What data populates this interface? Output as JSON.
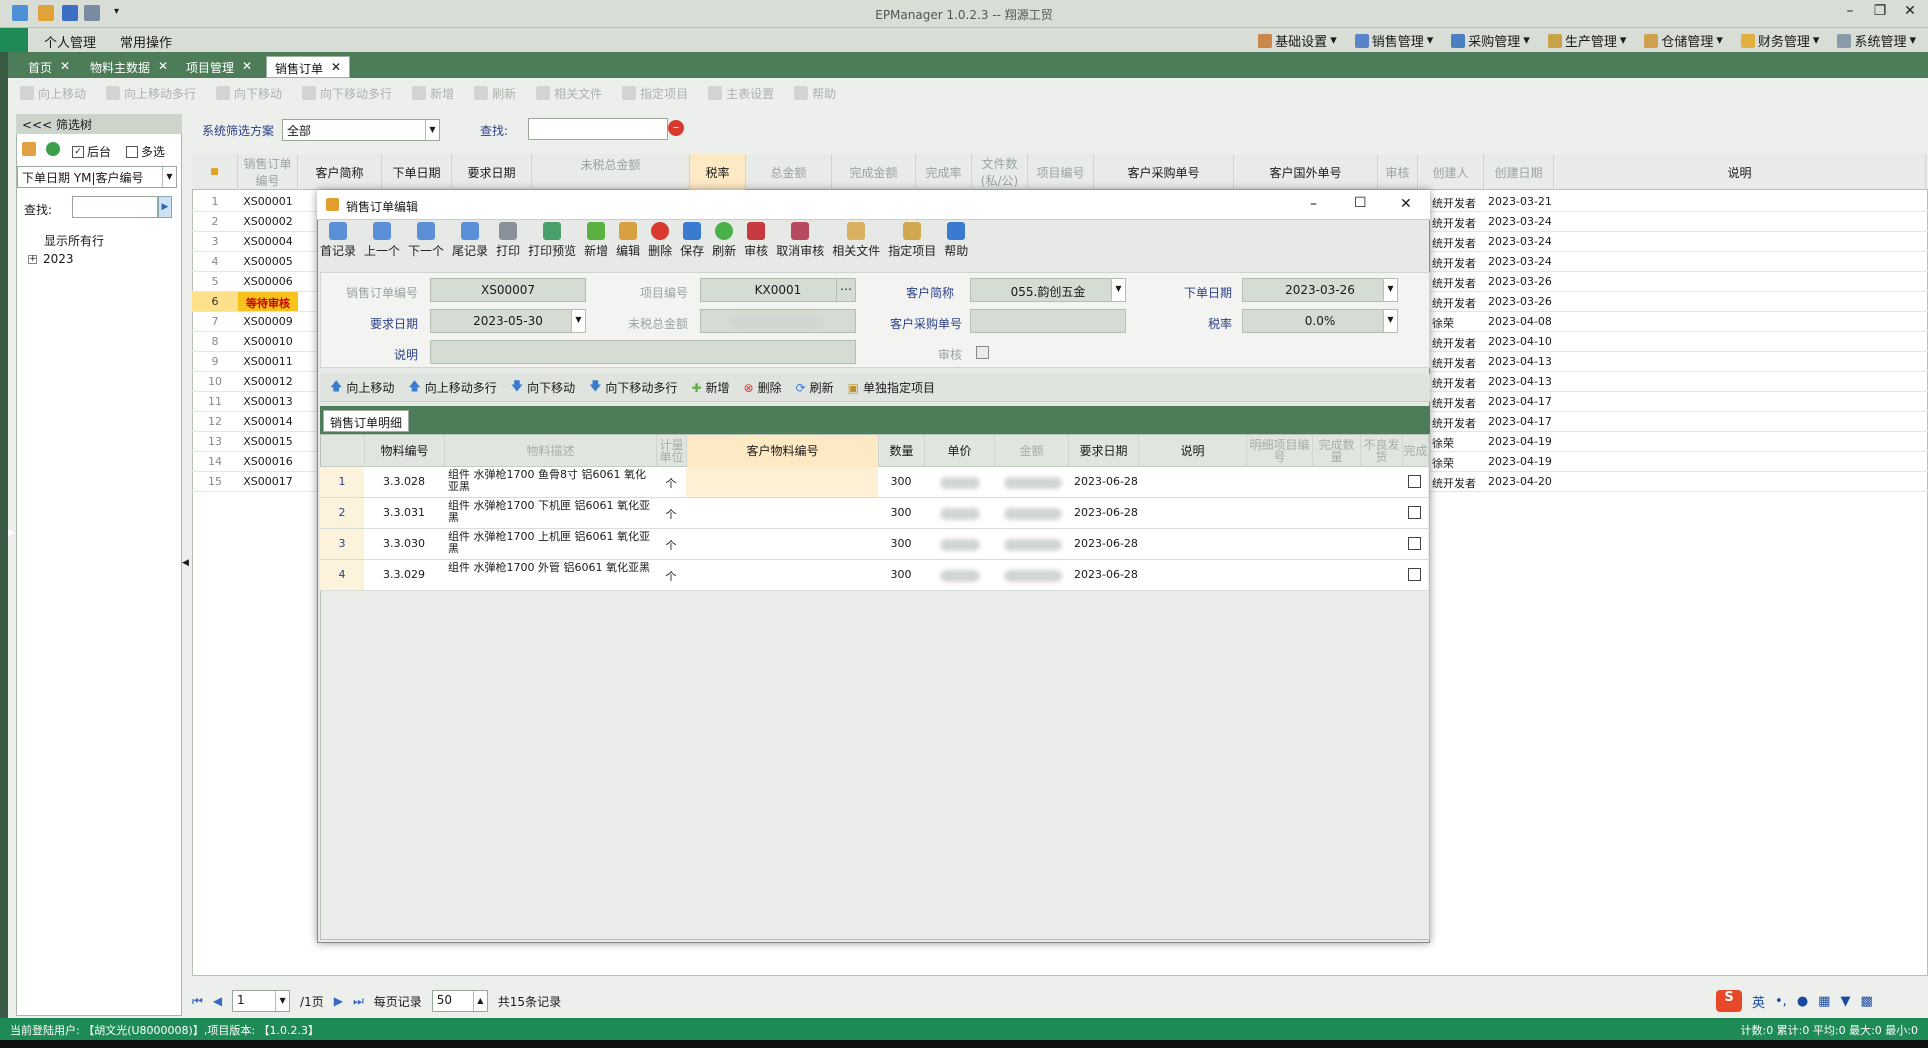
{
  "app": {
    "title": "EPManager 1.0.2.3 -- 翔源工贸"
  },
  "menu": {
    "left": [
      "个人管理",
      "常用操作"
    ],
    "right": [
      "基础设置",
      "销售管理",
      "采购管理",
      "生产管理",
      "仓储管理",
      "财务管理",
      "系统管理"
    ]
  },
  "tabs": [
    "首页",
    "物料主数据",
    "项目管理",
    "销售订单"
  ],
  "toolbar": [
    "向上移动",
    "向上移动多行",
    "向下移动",
    "向下移动多行",
    "新增",
    "刷新",
    "相关文件",
    "指定项目",
    "主表设置",
    "帮助"
  ],
  "filter": {
    "header": "<<< 筛选树",
    "backend_label": "后台",
    "multi_label": "多选",
    "group_by": "下单日期 YM|客户编号",
    "find_label": "查找:",
    "tree": [
      "显示所有行",
      "2023"
    ]
  },
  "scheme": {
    "label": "系统筛选方案",
    "value": "全部",
    "find_label": "查找:"
  },
  "grid": {
    "headers": [
      "销售订单编号",
      "客户简称",
      "下单日期",
      "要求日期",
      "未税总金额",
      "税率",
      "总金额",
      "完成金额",
      "完成率",
      "文件数(私/公)",
      "项目编号",
      "客户采购单号",
      "客户国外单号",
      "审核",
      "创建人",
      "创建日期",
      "说明"
    ],
    "rows": [
      {
        "no": "1",
        "id": "XS00001",
        "creator": "统开发者",
        "date": "2023-03-21"
      },
      {
        "no": "2",
        "id": "XS00002",
        "creator": "统开发者",
        "date": "2023-03-24"
      },
      {
        "no": "3",
        "id": "XS00004",
        "creator": "统开发者",
        "date": "2023-03-24"
      },
      {
        "no": "4",
        "id": "XS00005",
        "creator": "统开发者",
        "date": "2023-03-24"
      },
      {
        "no": "5",
        "id": "XS00006",
        "creator": "统开发者",
        "date": "2023-03-26"
      },
      {
        "no": "6",
        "id": "等待审核",
        "creator": "统开发者",
        "date": "2023-03-26"
      },
      {
        "no": "7",
        "id": "XS00009",
        "creator": "徐荣",
        "date": "2023-04-08"
      },
      {
        "no": "8",
        "id": "XS00010",
        "creator": "统开发者",
        "date": "2023-04-10"
      },
      {
        "no": "9",
        "id": "XS00011",
        "creator": "统开发者",
        "date": "2023-04-13"
      },
      {
        "no": "10",
        "id": "XS00012",
        "creator": "统开发者",
        "date": "2023-04-13"
      },
      {
        "no": "11",
        "id": "XS00013",
        "creator": "统开发者",
        "date": "2023-04-17"
      },
      {
        "no": "12",
        "id": "XS00014",
        "creator": "统开发者",
        "date": "2023-04-17"
      },
      {
        "no": "13",
        "id": "XS00015",
        "creator": "徐荣",
        "date": "2023-04-19"
      },
      {
        "no": "14",
        "id": "XS00016",
        "creator": "徐荣",
        "date": "2023-04-19"
      },
      {
        "no": "15",
        "id": "XS00017",
        "creator": "统开发者",
        "date": "2023-04-20"
      }
    ]
  },
  "pager": {
    "page": "1",
    "of": "/1页",
    "per_label": "每页记录",
    "per": "50",
    "total": "共15条记录"
  },
  "status": {
    "user": "当前登陆用户: 【胡文光(U8000008)】,项目版本: 【1.0.2.3】",
    "stats": "计数:0 累计:0 平均:0 最大:0 最小:0"
  },
  "dialog": {
    "title": "销售订单编辑",
    "toolbar": [
      "首记录",
      "上一个",
      "下一个",
      "尾记录",
      "打印",
      "打印预览",
      "新增",
      "编辑",
      "删除",
      "保存",
      "刷新",
      "审核",
      "取消审核",
      "相关文件",
      "指定项目",
      "帮助"
    ],
    "form": {
      "order_no_label": "销售订单编号",
      "order_no": "XS00007",
      "project_label": "项目编号",
      "project": "KX0001",
      "customer_label": "客户简称",
      "customer": "055.韵创五金",
      "order_date_label": "下单日期",
      "order_date": "2023-03-26",
      "req_date_label": "要求日期",
      "req_date": "2023-05-30",
      "untaxed_label": "未税总金额",
      "po_label": "客户采购单号",
      "tax_label": "税率",
      "tax": "0.0%",
      "note_label": "说明",
      "audit_label": "审核"
    },
    "sub_toolbar": [
      "向上移动",
      "向上移动多行",
      "向下移动",
      "向下移动多行",
      "新增",
      "删除",
      "刷新",
      "单独指定项目"
    ],
    "sub_tab": "销售订单明细",
    "detail_headers": [
      "物料编号",
      "物料描述",
      "计量单位",
      "客户物料编号",
      "数量",
      "单价",
      "金额",
      "要求日期",
      "说明",
      "明细项目编号",
      "完成数量",
      "不良发货",
      "完成"
    ],
    "details": [
      {
        "no": "1",
        "code": "3.3.028",
        "desc": "组件 水弹枪1700 鱼骨8寸 铝6061 氧化亚黑",
        "unit": "个",
        "qty": "300",
        "date": "2023-06-28"
      },
      {
        "no": "2",
        "code": "3.3.031",
        "desc": "组件 水弹枪1700 下机匣 铝6061 氧化亚黑",
        "unit": "个",
        "qty": "300",
        "date": "2023-06-28"
      },
      {
        "no": "3",
        "code": "3.3.030",
        "desc": "组件 水弹枪1700 上机匣 铝6061 氧化亚黑",
        "unit": "个",
        "qty": "300",
        "date": "2023-06-28"
      },
      {
        "no": "4",
        "code": "3.3.029",
        "desc": "组件 水弹枪1700 外管 铝6061 氧化亚黑",
        "unit": "个",
        "qty": "300",
        "date": "2023-06-28"
      }
    ]
  },
  "ime": {
    "lang": "英"
  }
}
